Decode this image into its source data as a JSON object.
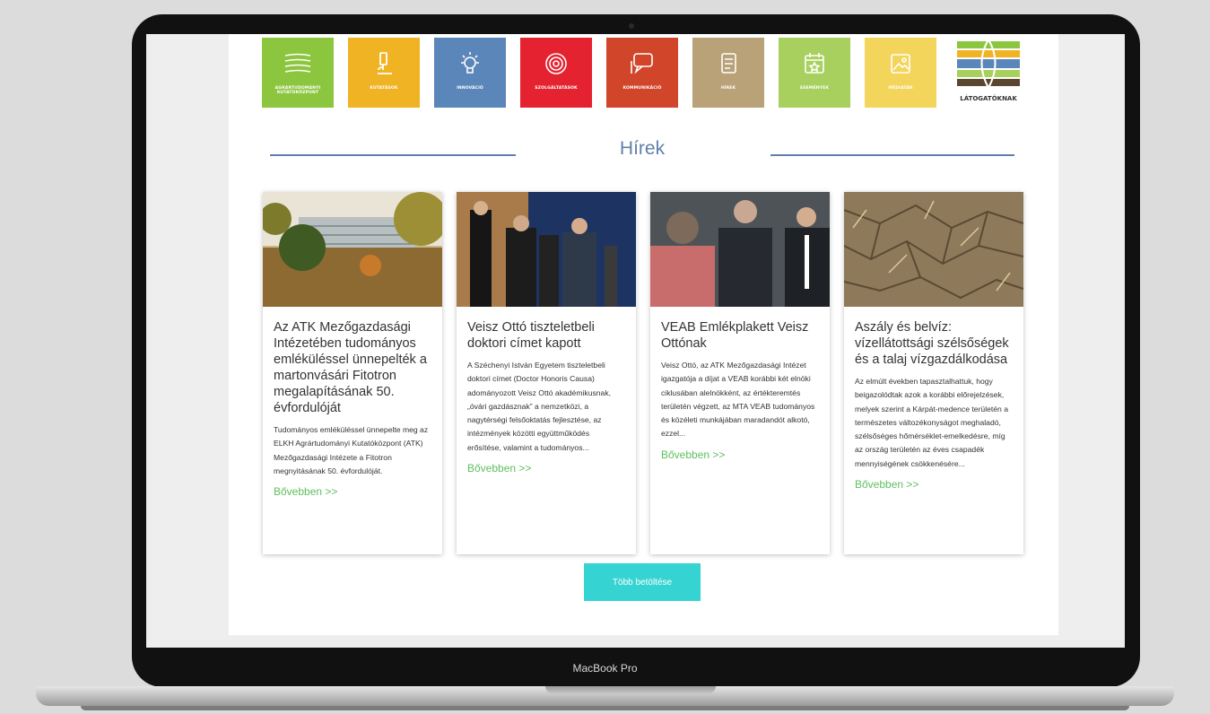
{
  "device": {
    "model_label": "MacBook Pro"
  },
  "categories": [
    {
      "label": "Agrártudományi Kutatóközpont",
      "color": "#8cc63f",
      "icon": "layers-icon"
    },
    {
      "label": "Kutatások",
      "color": "#f0b323",
      "icon": "microscope-icon"
    },
    {
      "label": "Innováció",
      "color": "#5b86b9",
      "icon": "lightbulb-icon"
    },
    {
      "label": "Szolgáltatások",
      "color": "#e52330",
      "icon": "target-icon"
    },
    {
      "label": "Kommunikáció",
      "color": "#d1452a",
      "icon": "chat-icon"
    },
    {
      "label": "Hírek",
      "color": "#b9a178",
      "icon": "news-icon"
    },
    {
      "label": "Események",
      "color": "#a7d05f",
      "icon": "calendar-icon"
    },
    {
      "label": "Médiatár",
      "color": "#f3d55b",
      "icon": "image-icon"
    }
  ],
  "visitors": {
    "label": "LÁTOGATÓKNAK"
  },
  "section": {
    "title": "Hírek"
  },
  "news": [
    {
      "title": "Az ATK Mezőgazdasági Intézetében tudományos emléküléssel ünnepelték a martonvásári Fitotron megalapításának 50. évfordulóját",
      "excerpt": "Tudományos emléküléssel ünnepelte meg az ELKH Agrártudományi Kutatóközpont (ATK) Mezőgazdasági Intézete a Fitotron megnyitásának 50. évfordulóját.",
      "more": "Bővebben >>"
    },
    {
      "title": "Veisz Ottó tiszteletbeli doktori címet kapott",
      "excerpt": "A Széchenyi István Egyetem tiszteletbeli doktori címet (Doctor Honoris Causa) adományozott Veisz Ottó akadémikusnak, „óvári gazdásznak” a nemzetközi, a nagytérségi felsőoktatás fejlesztése, az intézmények közötti együttműködés erősítése, valamint a tudományos...",
      "more": "Bővebben >>"
    },
    {
      "title": "VEAB Emlékplakett Veisz Ottónak",
      "excerpt": "Veisz Ottó, az ATK Mezőgazdasági Intézet igazgatója a díjat a VEAB korábbi két elnöki ciklusában alelnökként, az értékteremtés területén végzett, az MTA VEAB tudományos és közéleti munkájában maradandót alkotó, ezzel...",
      "more": "Bővebben >>"
    },
    {
      "title": "Aszály és belvíz: vízellátottsági szélsőségek és a talaj vízgazdálkodása",
      "excerpt": "Az elmúlt években tapasztalhattuk, hogy beigazolódtak azok a korábbi előrejelzések, melyek szerint a Kárpát-medence területén a természetes változékonyságot meghaladó, szélsőséges hőmérséklet-emelkedésre, míg az ország területén az éves csapadék mennyiségének csökkenésére...",
      "more": "Bővebben >>"
    }
  ],
  "load_more_label": "Több betöltése"
}
